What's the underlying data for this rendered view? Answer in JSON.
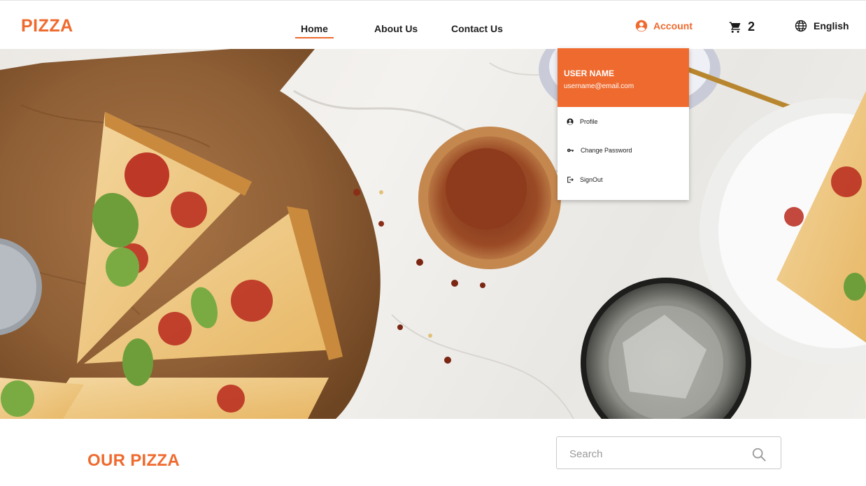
{
  "brand": "PIZZA",
  "nav": {
    "home": "Home",
    "about": "About Us",
    "contact": "Contact Us",
    "active": "Home"
  },
  "account": {
    "label": "Account",
    "icon": "account-circle-icon"
  },
  "cart": {
    "count": "2",
    "icon": "cart-icon"
  },
  "language": {
    "label": "English",
    "icon": "globe-icon"
  },
  "dropdown": {
    "user_name": "USER NAME",
    "email": "username@email.com",
    "items": [
      {
        "label": "Profile",
        "icon": "profile-icon"
      },
      {
        "label": "Change Password",
        "icon": "key-icon"
      },
      {
        "label": "SignOut",
        "icon": "signout-icon"
      }
    ]
  },
  "section": {
    "title": "OUR PIZZA"
  },
  "search": {
    "placeholder": "Search",
    "value": ""
  },
  "colors": {
    "accent": "#ef6a2e",
    "text": "#1a1a1a"
  }
}
